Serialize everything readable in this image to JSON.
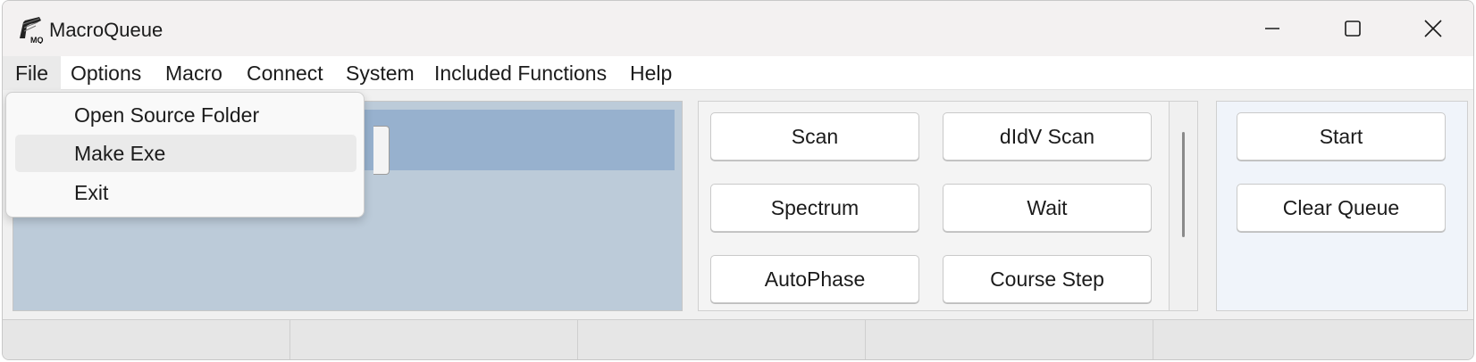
{
  "window": {
    "title": "MacroQueue",
    "app_icon": "mq-logo-icon"
  },
  "title_controls": [
    "minimize-icon",
    "maximize-icon",
    "close-icon"
  ],
  "menubar": {
    "items": [
      {
        "label": "File"
      },
      {
        "label": "Options"
      },
      {
        "label": "Macro"
      },
      {
        "label": "Connect"
      },
      {
        "label": "System"
      },
      {
        "label": "Included Functions"
      },
      {
        "label": "Help"
      }
    ],
    "active": "File"
  },
  "file_menu": {
    "items": [
      {
        "label": "Open Source Folder"
      },
      {
        "label": "Make Exe"
      },
      {
        "label": "Exit"
      }
    ],
    "hovered": "Make Exe"
  },
  "macro_buttons": {
    "row1": [
      "Scan",
      "dIdV Scan"
    ],
    "row2": [
      "Spectrum",
      "Wait"
    ],
    "row3": [
      "AutoPhase",
      "Course Step"
    ]
  },
  "queue_controls": {
    "start_label": "Start",
    "clear_label": "Clear Queue"
  },
  "colors": {
    "queue_panel_bg": "#bccbd9",
    "queue_selected_bg": "#97b1ce",
    "right_panel_bg": "#f0f4fa"
  }
}
